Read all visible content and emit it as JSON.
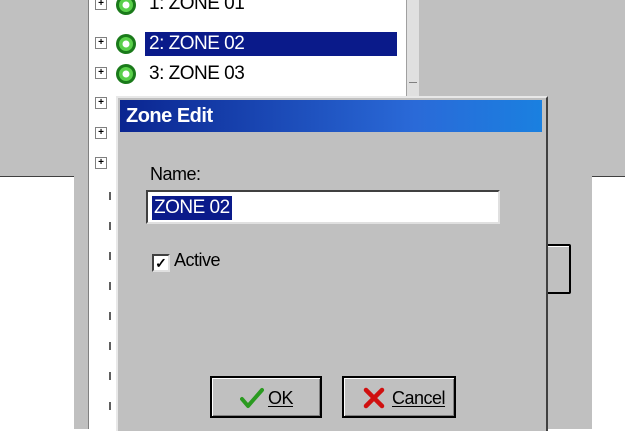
{
  "tree": {
    "rows": [
      {
        "label": "1: ZONE 01",
        "selected": false
      },
      {
        "label": "2: ZONE 02",
        "selected": true
      },
      {
        "label": "3: ZONE 03",
        "selected": false
      }
    ]
  },
  "dialog": {
    "title": "Zone Edit",
    "name_label": "Name:",
    "name_value": "ZONE 02",
    "active_label": "Active",
    "active_checked": true,
    "ok_label": "OK",
    "cancel_label": "Cancel"
  },
  "colors": {
    "selection": "#0a1a8a",
    "title_bar": "#0a2590",
    "window_bg": "#c0c0c0",
    "ok_check": "#2a9a20",
    "cancel_x": "#d01010"
  },
  "icons": {
    "zone": "green-zone-icon",
    "ok": "checkmark-icon",
    "cancel": "red-x-icon"
  }
}
